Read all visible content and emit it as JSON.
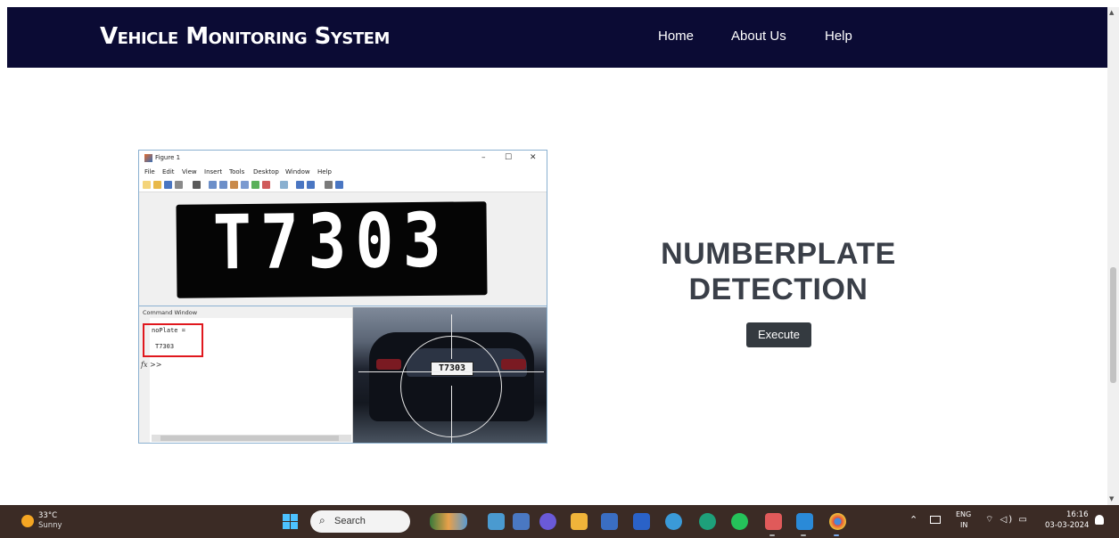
{
  "navbar": {
    "brand": "Vehicle Monitoring System",
    "links": [
      "Home",
      "About Us",
      "Help"
    ]
  },
  "figure": {
    "window_title": "Figure 1",
    "window_controls": [
      "–",
      "☐",
      "✕"
    ],
    "menu": [
      "File",
      "Edit",
      "View",
      "Insert",
      "Tools",
      "Desktop",
      "Window",
      "Help"
    ],
    "plate_binary_text": "T7303",
    "command_window": {
      "header": "Command Window",
      "variable_line": "noPlate =",
      "value_line": "T7303",
      "prompt": "fx >>"
    },
    "car_plate_text": "T7303"
  },
  "main": {
    "heading_line1": "NUMBERPLATE",
    "heading_line2": "DETECTION",
    "execute_label": "Execute"
  },
  "taskbar": {
    "weather_temp": "33°C",
    "weather_condition": "Sunny",
    "search_label": "Search",
    "search_icon": "search-icon",
    "lang_line1": "ENG",
    "lang_line2": "IN",
    "time": "16:16",
    "date": "03-03-2024"
  },
  "colors": {
    "navbar_bg": "#0b0b34",
    "button_bg": "#343a40",
    "heading": "#3a3f48",
    "taskbar_bg": "#3b2b25",
    "highlight_red": "#e0181e"
  }
}
